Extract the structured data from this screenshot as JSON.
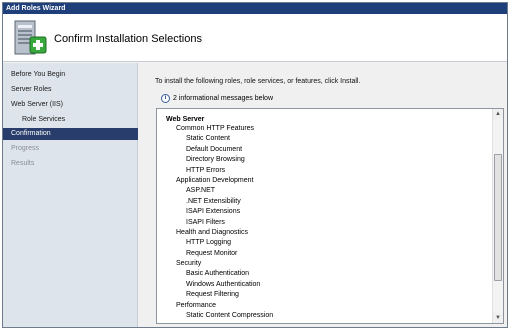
{
  "window": {
    "title": "Add Roles Wizard"
  },
  "header": {
    "title": "Confirm Installation Selections",
    "icon": "server-add-roles-icon"
  },
  "sidebar": {
    "items": [
      {
        "label": "Before You Begin",
        "state": "normal",
        "indent": false
      },
      {
        "label": "Server Roles",
        "state": "normal",
        "indent": false
      },
      {
        "label": "Web Server (IIS)",
        "state": "normal",
        "indent": false
      },
      {
        "label": "Role Services",
        "state": "normal",
        "indent": true
      },
      {
        "label": "Confirmation",
        "state": "active",
        "indent": false
      },
      {
        "label": "Progress",
        "state": "disabled",
        "indent": false
      },
      {
        "label": "Results",
        "state": "disabled",
        "indent": false
      }
    ]
  },
  "main": {
    "intro": "To install the following roles, role services, or features, click Install.",
    "info_message": "2 informational messages below",
    "list": [
      {
        "text": "Web Server",
        "level": 0,
        "bold": true
      },
      {
        "text": "Common HTTP Features",
        "level": 1,
        "bold": false
      },
      {
        "text": "Static Content",
        "level": 2,
        "bold": false
      },
      {
        "text": "Default Document",
        "level": 2,
        "bold": false
      },
      {
        "text": "Directory Browsing",
        "level": 2,
        "bold": false
      },
      {
        "text": "HTTP Errors",
        "level": 2,
        "bold": false
      },
      {
        "text": "Application Development",
        "level": 1,
        "bold": false
      },
      {
        "text": "ASP.NET",
        "level": 2,
        "bold": false
      },
      {
        "text": ".NET Extensibility",
        "level": 2,
        "bold": false
      },
      {
        "text": "ISAPI Extensions",
        "level": 2,
        "bold": false
      },
      {
        "text": "ISAPI Filters",
        "level": 2,
        "bold": false
      },
      {
        "text": "Health and Diagnostics",
        "level": 1,
        "bold": false
      },
      {
        "text": "HTTP Logging",
        "level": 2,
        "bold": false
      },
      {
        "text": "Request Monitor",
        "level": 2,
        "bold": false
      },
      {
        "text": "Security",
        "level": 1,
        "bold": false
      },
      {
        "text": "Basic Authentication",
        "level": 2,
        "bold": false
      },
      {
        "text": "Windows Authentication",
        "level": 2,
        "bold": false
      },
      {
        "text": "Request Filtering",
        "level": 2,
        "bold": false
      },
      {
        "text": "Performance",
        "level": 1,
        "bold": false
      },
      {
        "text": "Static Content Compression",
        "level": 2,
        "bold": false
      }
    ]
  },
  "colors": {
    "title_bar": "#1e3f7a",
    "sidebar_bg": "#dde4ec",
    "active_item": "#283d6b",
    "panel_bg": "#f0f0f0"
  }
}
